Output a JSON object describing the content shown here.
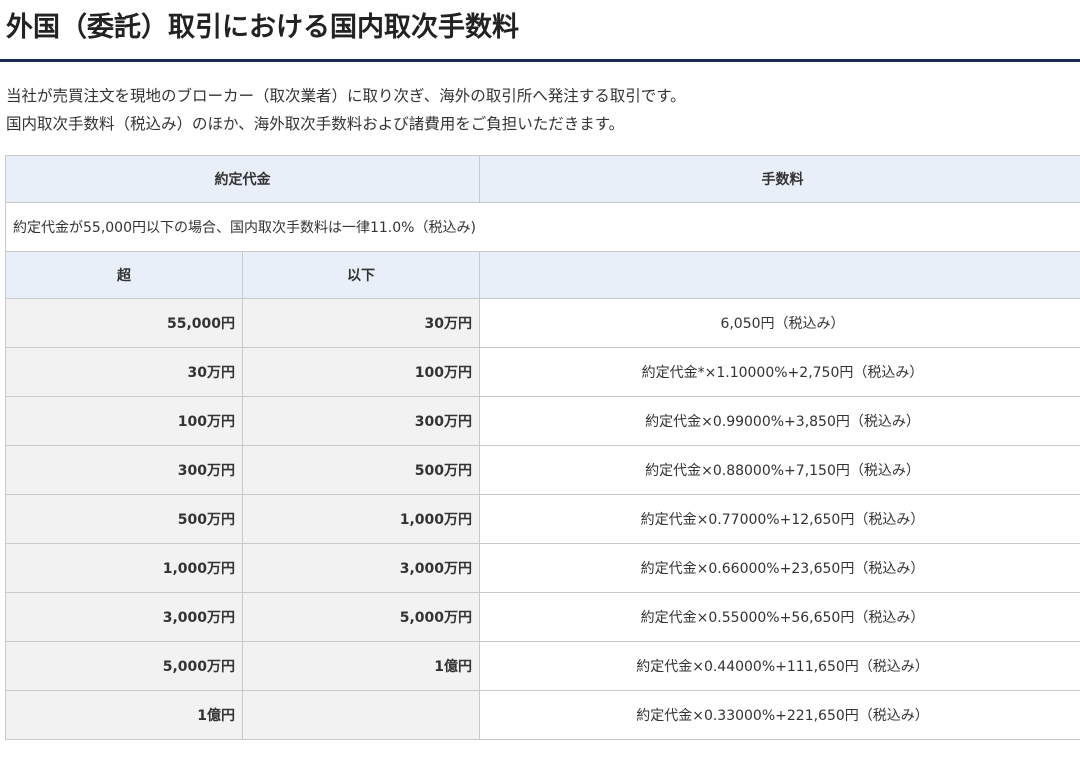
{
  "page": {
    "title": "外国（委託）取引における国内取次手数料",
    "intro_line1": "当社が売買注文を現地のブローカー（取次業者）に取り次ぎ、海外の取引所へ発注する取引です。",
    "intro_line2": "国内取次手数料（税込み）のほか、海外取次手数料および諸費用をご負担いただきます。"
  },
  "table": {
    "header_amount": "約定代金",
    "header_fee": "手数料",
    "note": "約定代金が55,000円以下の場合、国内取次手数料は一律11.0%（税込み)",
    "sub_over": "超",
    "sub_under": "以下",
    "rows": [
      {
        "over": "55,000円",
        "under": "30万円",
        "fee": "6,050円（税込み）"
      },
      {
        "over": "30万円",
        "under": "100万円",
        "fee": "約定代金*×1.10000%+2,750円（税込み）"
      },
      {
        "over": "100万円",
        "under": "300万円",
        "fee": "約定代金×0.99000%+3,850円（税込み）"
      },
      {
        "over": "300万円",
        "under": "500万円",
        "fee": "約定代金×0.88000%+7,150円（税込み）"
      },
      {
        "over": "500万円",
        "under": "1,000万円",
        "fee": "約定代金×0.77000%+12,650円（税込み）"
      },
      {
        "over": "1,000万円",
        "under": "3,000万円",
        "fee": "約定代金×0.66000%+23,650円（税込み）"
      },
      {
        "over": "3,000万円",
        "under": "5,000万円",
        "fee": "約定代金×0.55000%+56,650円（税込み）"
      },
      {
        "over": "5,000万円",
        "under": "1億円",
        "fee": "約定代金×0.44000%+111,650円（税込み）"
      },
      {
        "over": "1億円",
        "under": "",
        "fee": "約定代金×0.33000%+221,650円（税込み）"
      }
    ]
  }
}
